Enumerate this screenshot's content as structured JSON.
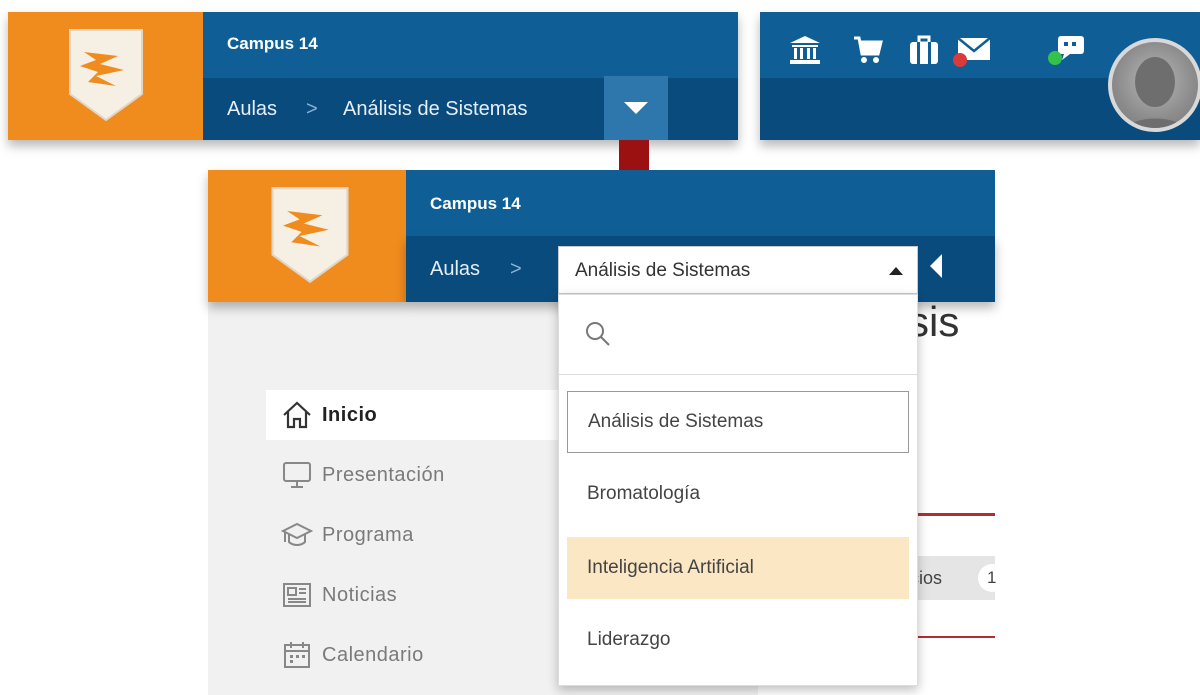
{
  "header": {
    "site_title": "Campus 14",
    "breadcrumb_root": "Aulas",
    "breadcrumb_sep": ">",
    "breadcrumb_current": "Análisis de Sistemas",
    "icons": [
      "institution-icon",
      "cart-icon",
      "briefcase-icon",
      "mail-icon",
      "chat-icon"
    ]
  },
  "course_select": {
    "value": "Análisis de Sistemas",
    "search_placeholder": "",
    "options": [
      {
        "label": "Análisis de Sistemas",
        "state": "selected"
      },
      {
        "label": "Bromatología",
        "state": "normal"
      },
      {
        "label": "Inteligencia Artificial",
        "state": "hover"
      },
      {
        "label": "Liderazgo",
        "state": "normal"
      }
    ]
  },
  "sidebar": {
    "items": [
      {
        "label": "Inicio",
        "icon": "home-icon",
        "active": true
      },
      {
        "label": "Presentación",
        "icon": "monitor-icon",
        "active": false
      },
      {
        "label": "Programa",
        "icon": "graduation-cap-icon",
        "active": false
      },
      {
        "label": "Noticias",
        "icon": "newspaper-icon",
        "active": false
      },
      {
        "label": "Calendario",
        "icon": "calendar-icon",
        "active": false
      }
    ]
  },
  "content": {
    "heading_fragment": "sis",
    "tab_fragment": "cios",
    "tab_count_fragment": "1"
  },
  "colors": {
    "brand_orange": "#f08c1e",
    "header_blue": "#0f5f96",
    "header_dark_blue": "#0a4b7e",
    "arrow_red": "#9b1111",
    "hover_highlight": "#fbe7c4"
  }
}
